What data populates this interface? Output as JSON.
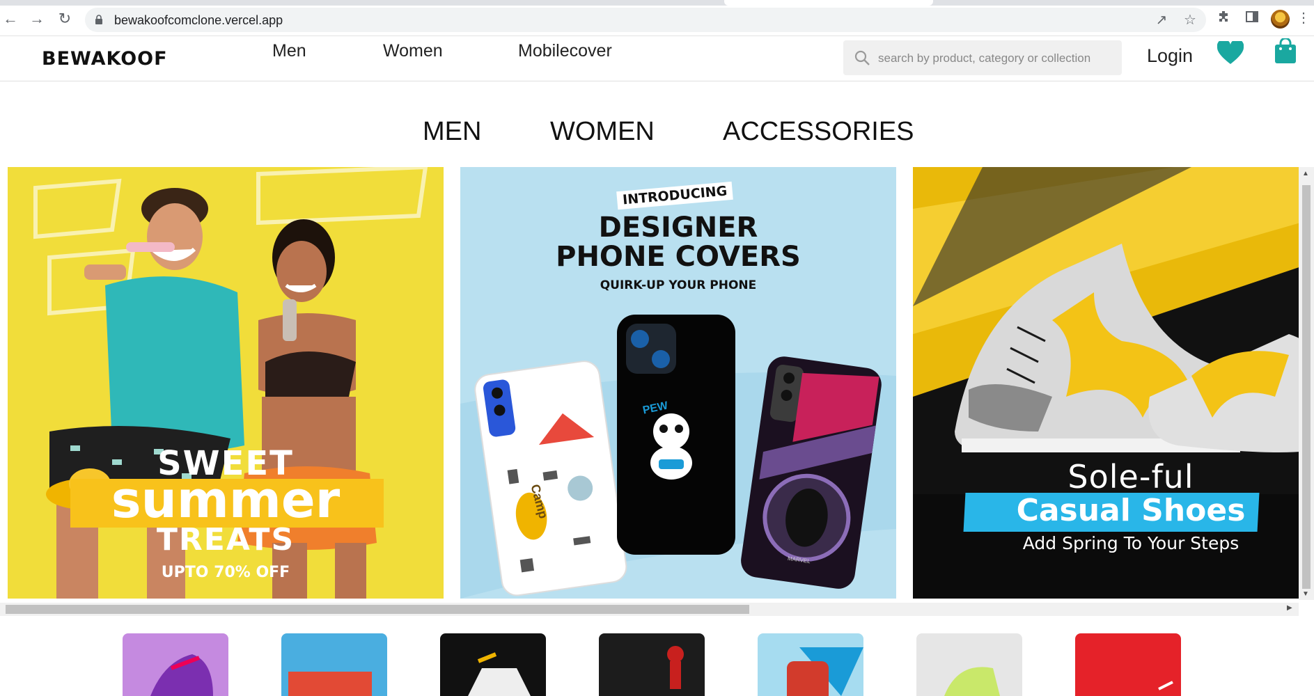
{
  "browser": {
    "url": "bewakoofcomclone.vercel.app"
  },
  "header": {
    "logo": "BEWAKOOF",
    "nav": [
      "Men",
      "Women",
      "Mobilecover"
    ],
    "search_placeholder": "search by product, category or collection",
    "login": "Login"
  },
  "categories": [
    "MEN",
    "WOMEN",
    "ACCESSORIES"
  ],
  "banners": {
    "summer": {
      "line1": "SWEET",
      "line2": "summer",
      "line3": "TREATS",
      "offer": "UPTO 70% OFF"
    },
    "covers": {
      "tag": "INTRODUCING",
      "line1": "DESIGNER",
      "line2": "PHONE COVERS",
      "sub": "QUIRK-UP YOUR PHONE",
      "case_text": "PEW",
      "case_text2": "Camp",
      "brand": "MARVEL"
    },
    "shoes": {
      "line1": "Sole-ful",
      "line2": "Casual Shoes",
      "line3": "Add Spring To Your Steps"
    }
  },
  "colors": {
    "accent": "#1aa8a0",
    "summer_yellow": "#f1dd3a",
    "covers_blue": "#b9e0f0",
    "shoes_cyan": "#29b6e8"
  }
}
